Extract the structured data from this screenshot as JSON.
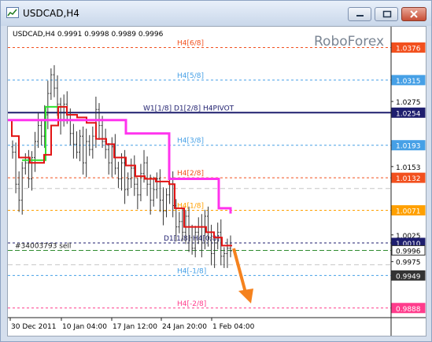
{
  "window": {
    "title": "USDCAD,H4",
    "buttons": [
      "minimize",
      "restore",
      "close"
    ]
  },
  "chart_info": {
    "header": "USDCAD,H4  0.9991 0.9998 0.9989 0.9996",
    "watermark": "RoboForex"
  },
  "price_axis": {
    "labels": [
      "1.0376",
      "1.0315",
      "1.0275",
      "1.0254",
      "1.0193",
      "1.0153",
      "1.0132",
      "1.0071",
      "1.0025",
      "1.0010",
      "0.9996",
      "0.9975",
      "0.9949",
      "0.9888"
    ]
  },
  "time_axis": {
    "labels": [
      "30 Dec 2011",
      "10 Jan 04:00",
      "17 Jan 12:00",
      "24 Jan 20:00",
      "1 Feb 04:00"
    ]
  },
  "murrey_levels": [
    {
      "label": "H4[6/8]",
      "price": 1.0376,
      "color": "#f2501e"
    },
    {
      "label": "H4[5/8]",
      "price": 1.0315,
      "color": "#46a0e6"
    },
    {
      "label": "W1[1/8] D1[2/8] H4PIVOT",
      "price": 1.0254,
      "color": "#1e1e6e"
    },
    {
      "label": "H4[3/8]",
      "price": 1.0193,
      "color": "#46a0e6"
    },
    {
      "label": "H4[2/8]",
      "price": 1.0132,
      "color": "#f2501e"
    },
    {
      "label": "H4[1/8]",
      "price": 1.0071,
      "color": "#ffa000"
    },
    {
      "label": "D1[1/8] H4[0/8]",
      "price": 1.001,
      "color": "#1e1e6e"
    },
    {
      "label": "H4[-1/8]",
      "price": 0.9949,
      "color": "#46a0e6"
    },
    {
      "label": "H4[-2/8]",
      "price": 0.9888,
      "color": "#ff3c8c"
    }
  ],
  "extra_lines": [
    {
      "label": "#34003793 sell",
      "price": 0.9996,
      "color": "#2e8b2e"
    }
  ],
  "price_range": [
    0.987,
    1.0415
  ],
  "colors": {
    "current_price_bg": "#ffffff",
    "accent_arrow": "#f5821e"
  }
}
